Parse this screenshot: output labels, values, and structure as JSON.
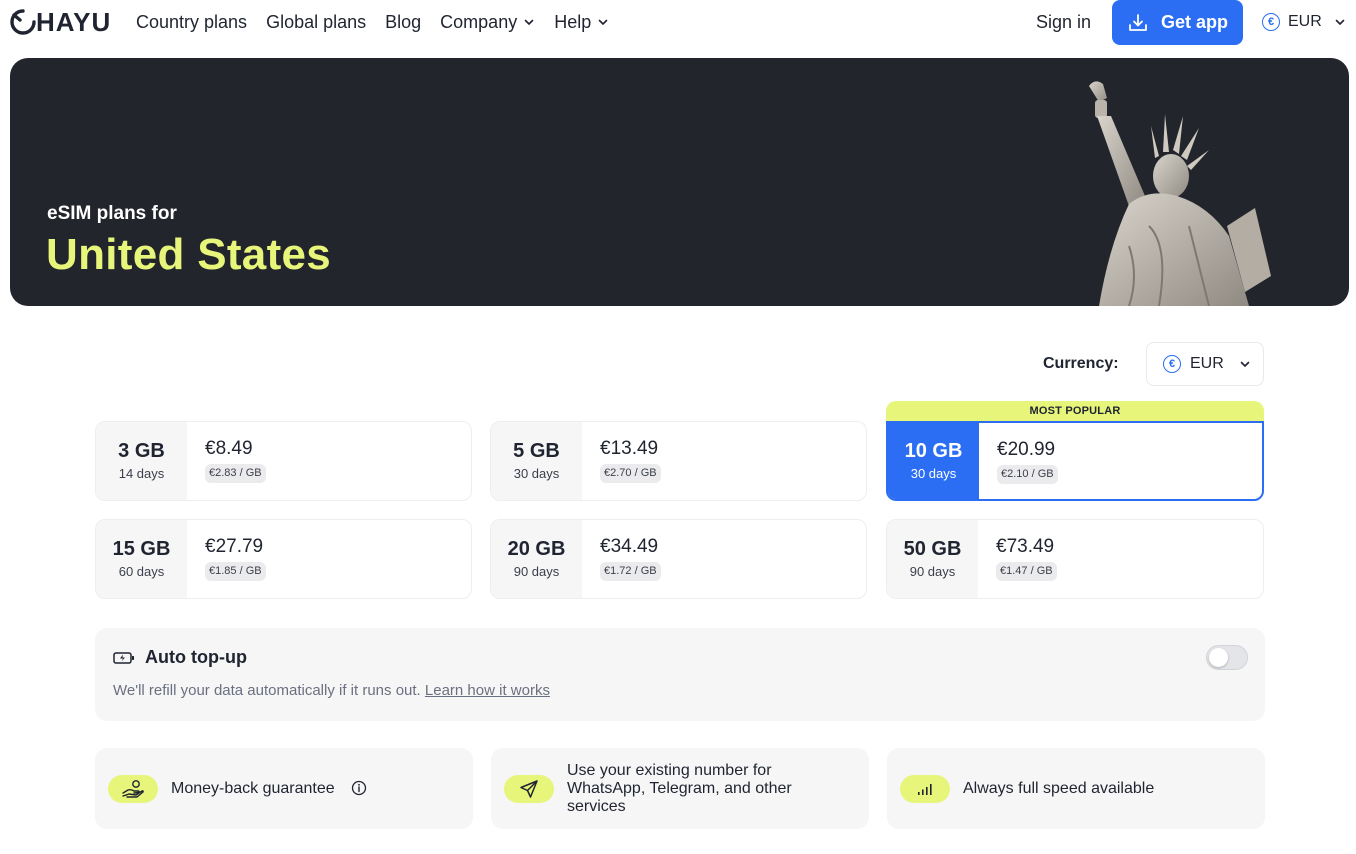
{
  "nav": {
    "logo_text": "HAYU",
    "links": [
      {
        "label": "Country plans"
      },
      {
        "label": "Global plans"
      },
      {
        "label": "Blog"
      },
      {
        "label": "Company"
      },
      {
        "label": "Help"
      }
    ],
    "sign_in": "Sign in",
    "get_app": "Get app",
    "currency": "EUR",
    "currency_symbol": "€"
  },
  "hero": {
    "subtitle": "eSIM plans for",
    "title": "United States"
  },
  "currency_selector": {
    "label": "Currency:",
    "value": "EUR",
    "symbol": "€"
  },
  "popular_badge": "MOST POPULAR",
  "plans": [
    {
      "gb": "3 GB",
      "days": "14 days",
      "price": "€8.49",
      "per_gb": "€2.83 / GB"
    },
    {
      "gb": "5 GB",
      "days": "30 days",
      "price": "€13.49",
      "per_gb": "€2.70 / GB"
    },
    {
      "gb": "10 GB",
      "days": "30 days",
      "price": "€20.99",
      "per_gb": "€2.10 / GB"
    },
    {
      "gb": "15 GB",
      "days": "60 days",
      "price": "€27.79",
      "per_gb": "€1.85 / GB"
    },
    {
      "gb": "20 GB",
      "days": "90 days",
      "price": "€34.49",
      "per_gb": "€1.72 / GB"
    },
    {
      "gb": "50 GB",
      "days": "90 days",
      "price": "€73.49",
      "per_gb": "€1.47 / GB"
    }
  ],
  "auto_topup": {
    "title": "Auto top-up",
    "description": "We'll refill your data automatically if it runs out.",
    "link": "Learn how it works"
  },
  "features": [
    {
      "icon": "hand-coins-icon",
      "text": "Money-back guarantee"
    },
    {
      "icon": "paper-plane-icon",
      "text": "Use your existing number for WhatsApp, Telegram, and other services"
    },
    {
      "icon": "signal-bars-icon",
      "text": "Always full speed available"
    }
  ],
  "colors": {
    "accent": "#2b6ef3",
    "highlight": "#e7f57a",
    "hero_bg": "#22252b"
  }
}
